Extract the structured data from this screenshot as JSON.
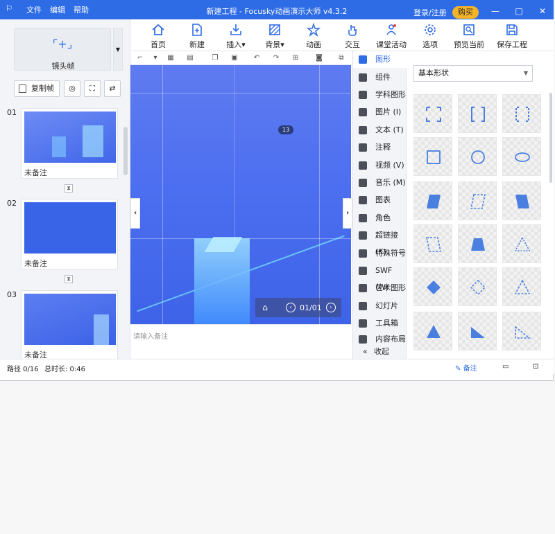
{
  "titlebar": {
    "menus": [
      "文件",
      "编辑",
      "帮助"
    ],
    "title": "新建工程 - Focusky动画演示大师 v4.3.2",
    "login": "登录/注册",
    "buy": "购买",
    "controls": [
      "—",
      "□",
      "✕"
    ]
  },
  "ribbon": [
    {
      "label": "首页",
      "icon": "home-icon"
    },
    {
      "label": "新建",
      "icon": "new-icon"
    },
    {
      "label": "插入▾",
      "icon": "insert-icon"
    },
    {
      "label": "背景▾",
      "icon": "background-icon"
    },
    {
      "label": "动画",
      "icon": "animation-icon"
    },
    {
      "label": "交互",
      "icon": "interaction-icon"
    },
    {
      "label": "课堂活动",
      "icon": "classroom-icon"
    },
    {
      "label": "选项",
      "icon": "options-icon"
    },
    {
      "label": "预览当前",
      "icon": "preview-icon"
    },
    {
      "label": "保存工程",
      "icon": "save-icon"
    }
  ],
  "left": {
    "camera_frame": "镜头帧",
    "copy_frame": "复制帧",
    "slides": [
      {
        "num": "01",
        "note": "未备注"
      },
      {
        "num": "02",
        "note": "未备注"
      },
      {
        "num": "03",
        "note": "未备注"
      }
    ]
  },
  "canvas": {
    "badge": "13",
    "page": "01/01",
    "notes_placeholder": "请输入备注"
  },
  "categories": [
    {
      "label": "图形",
      "active": true
    },
    {
      "label": "组件"
    },
    {
      "label": "学科图形"
    },
    {
      "label": "图片 (I)"
    },
    {
      "label": "文本 (T)"
    },
    {
      "label": "注释"
    },
    {
      "label": "视频 (V)"
    },
    {
      "label": "音乐 (M)"
    },
    {
      "label": "图表"
    },
    {
      "label": "角色"
    },
    {
      "label": "超链接 (K)"
    },
    {
      "label": "特殊符号"
    },
    {
      "label": "SWF (W)"
    },
    {
      "label": "艺术图形"
    },
    {
      "label": "幻灯片"
    },
    {
      "label": "工具箱"
    },
    {
      "label": "内容布局"
    }
  ],
  "collapse_label": "收起",
  "shape_select": "基本形状",
  "status": {
    "path": "路径 0/16",
    "duration": "总时长: 0:46",
    "notes": "备注"
  },
  "colors": {
    "accent": "#2e6ce6",
    "buy": "#f5b428"
  }
}
